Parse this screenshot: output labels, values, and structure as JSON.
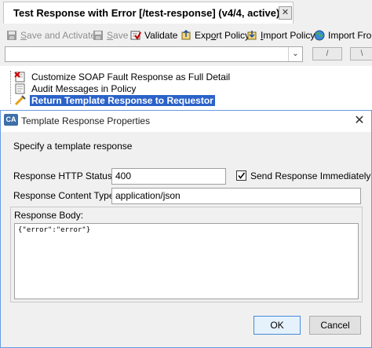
{
  "tab": {
    "title": "Test Response with Error [/test-response] (v4/4, active)",
    "close": "✕"
  },
  "toolbar": {
    "save_activate": {
      "pre": "",
      "ul": "S",
      "post": "ave and Activate"
    },
    "save": {
      "pre": "",
      "ul": "S",
      "post": "ave"
    },
    "validate": "Validate",
    "export": {
      "pre": "Exp",
      "ul": "o",
      "post": "rt Policy"
    },
    "import": {
      "pre": "",
      "ul": "I",
      "post": "mport Policy"
    },
    "import_from": "Import From"
  },
  "filter": {
    "value": "",
    "arrow": "⌄",
    "btn1": "/",
    "btn2": "\\"
  },
  "tree": {
    "items": [
      {
        "label": "Customize SOAP Fault Response as Full Detail",
        "icon": "soap-fault-icon",
        "selected": false
      },
      {
        "label": "Audit Messages in Policy",
        "icon": "audit-icon",
        "selected": false
      },
      {
        "label": "Return Template Response to Requestor",
        "icon": "template-response-icon",
        "selected": true
      }
    ]
  },
  "dialog": {
    "title": "Template Response Properties",
    "app_icon": "CA",
    "close": "✕",
    "subtitle": "Specify a template response",
    "status_label": "Response HTTP Status:",
    "status_value": "400",
    "send_immediately_label": "Send Response Immediately",
    "send_immediately_checked": true,
    "content_type_label": "Response Content Type:",
    "content_type_value": "application/json",
    "body_label": "Response Body:",
    "body_value": "{\"error\":\"error\"}",
    "ok": "OK",
    "cancel": "Cancel"
  },
  "colors": {
    "selection": "#2b62c9",
    "dialog_border": "#6a9ae2",
    "default_button": "#4a8ad8"
  }
}
